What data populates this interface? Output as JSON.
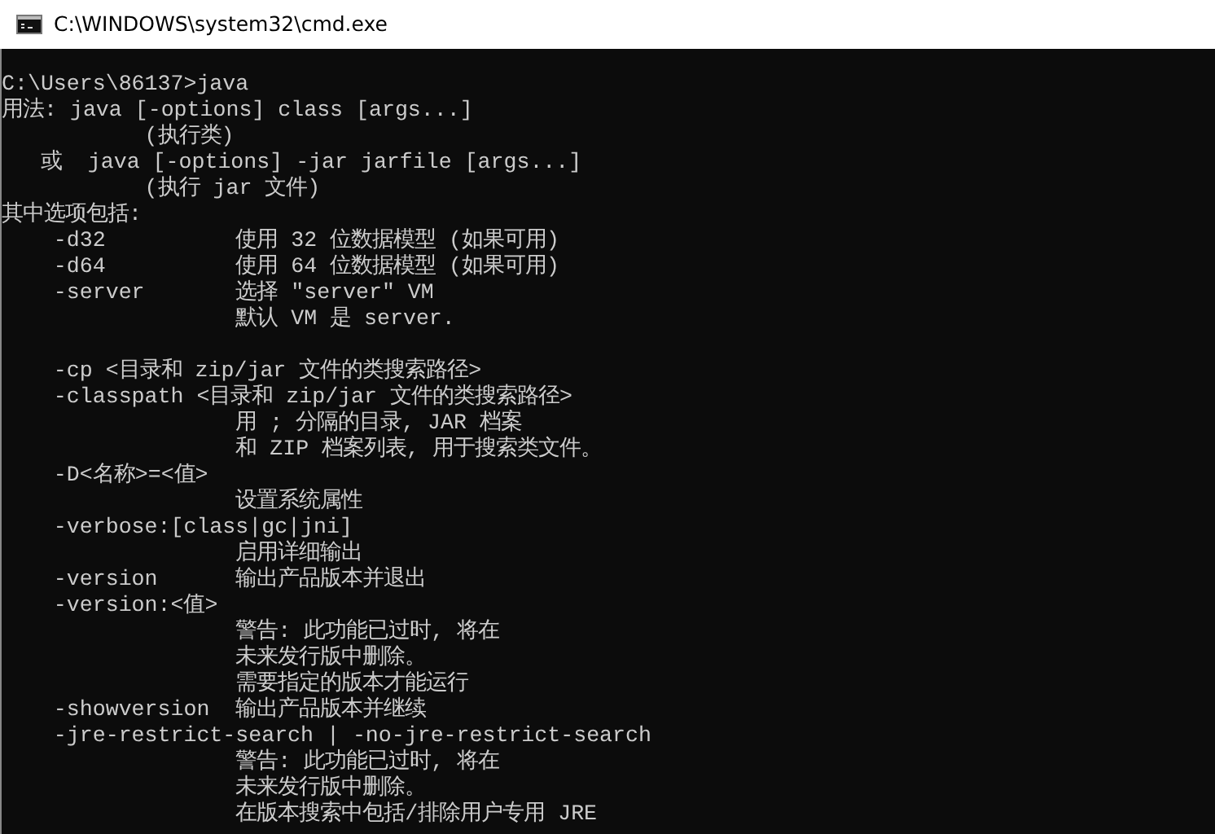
{
  "window": {
    "title": "C:\\WINDOWS\\system32\\cmd.exe"
  },
  "console": {
    "blocks": [
      {
        "lines": [
          "C:\\Users\\86137>java",
          "用法: java [-options] class [args...]",
          "           (执行类)",
          "   或  java [-options] -jar jarfile [args...]",
          "           (执行 jar 文件)",
          "其中选项包括:",
          "    -d32          使用 32 位数据模型 (如果可用)",
          "    -d64          使用 64 位数据模型 (如果可用)",
          "    -server       选择 \"server\" VM",
          "                  默认 VM 是 server."
        ]
      },
      {
        "lines": [
          "    -cp <目录和 zip/jar 文件的类搜索路径>",
          "    -classpath <目录和 zip/jar 文件的类搜索路径>",
          "                  用 ; 分隔的目录, JAR 档案",
          "                  和 ZIP 档案列表, 用于搜索类文件。",
          "    -D<名称>=<值>",
          "                  设置系统属性",
          "    -verbose:[class|gc|jni]",
          "                  启用详细输出",
          "    -version      输出产品版本并退出",
          "    -version:<值>",
          "                  警告: 此功能已过时, 将在",
          "                  未来发行版中删除。",
          "                  需要指定的版本才能运行",
          "    -showversion  输出产品版本并继续",
          "    -jre-restrict-search | -no-jre-restrict-search",
          "                  警告: 此功能已过时, 将在",
          "                  未来发行版中删除。",
          "                  在版本搜索中包括/排除用户专用 JRE"
        ]
      }
    ]
  }
}
